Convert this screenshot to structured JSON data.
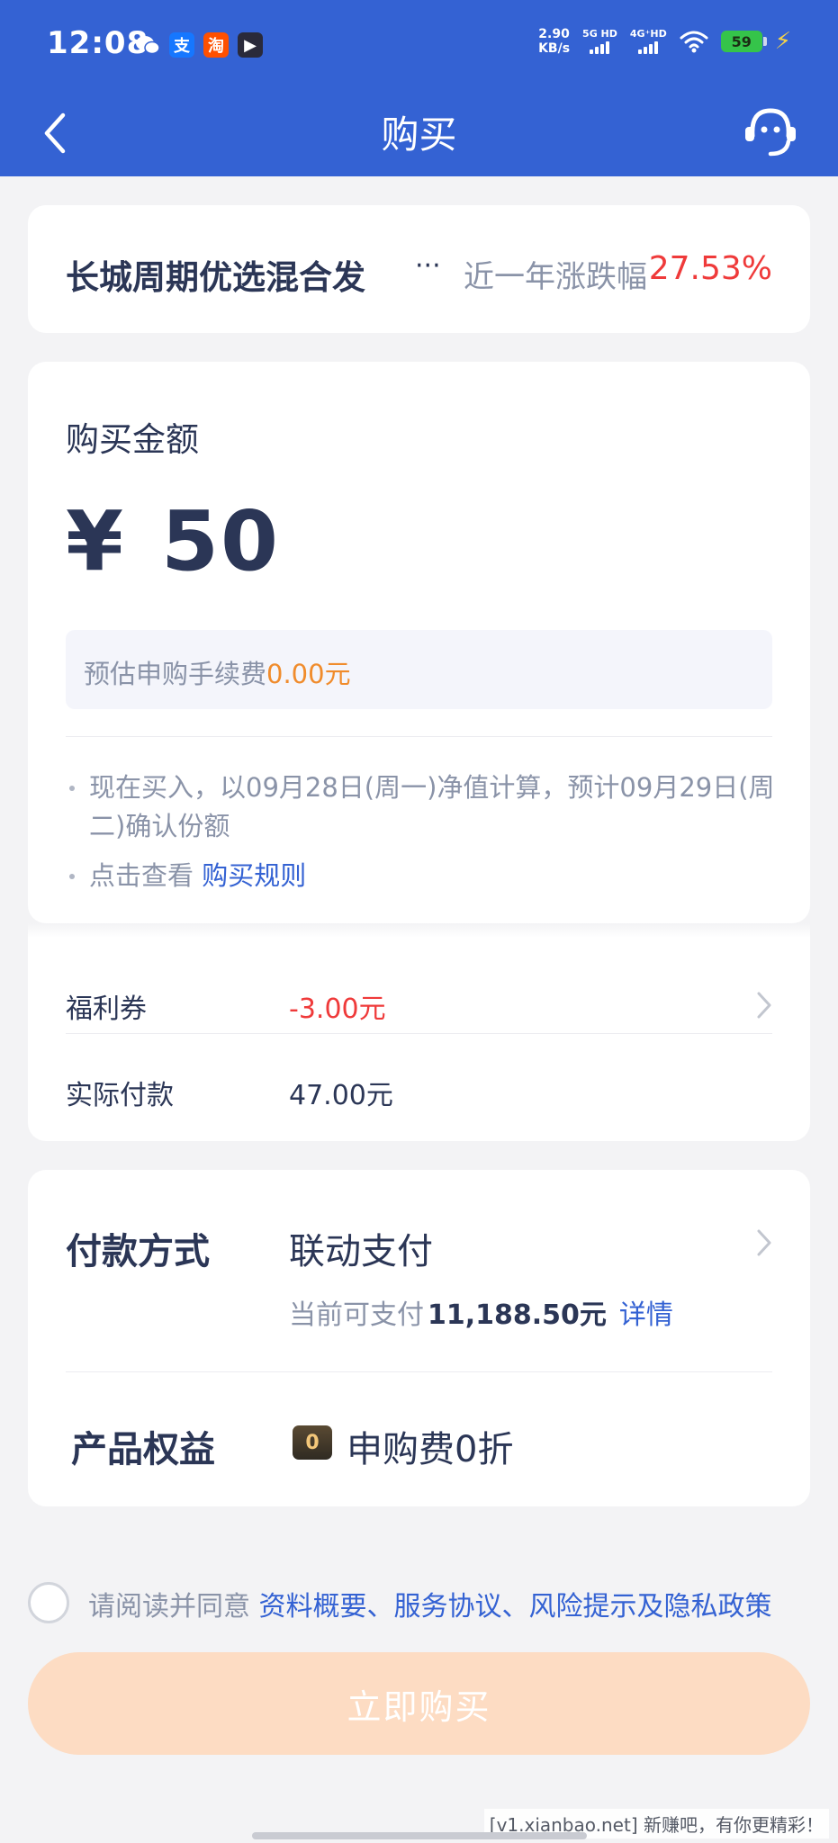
{
  "status_bar": {
    "time": "12:08",
    "app_icons": [
      "wechat-icon",
      "alipay-icon",
      "taobao-icon",
      "video-app-icon"
    ],
    "app_glyphs": {
      "alipay": "支",
      "taobao": "淘",
      "video": "▶"
    },
    "net_speed_value": "2.90",
    "net_speed_unit": "KB/s",
    "signal1_label": "5G HD",
    "signal2_label": "4G⁺HD",
    "battery_level": "59"
  },
  "header": {
    "title": "购买",
    "back_icon": "chevron-left-icon",
    "service_icon": "customer-service-icon",
    "background_color": "#3462d3"
  },
  "fund": {
    "name": "长城周期优选混合发",
    "ellipsis": "···",
    "yield_label": "近一年涨跌幅",
    "yield_value": "27.53%",
    "yield_color": "#ef3a3a"
  },
  "amount": {
    "label": "购买金额",
    "currency": "¥",
    "value": "50",
    "fee_label": "预估申购手续费",
    "fee_value": "0.00元",
    "notes": [
      "现在买入，以09月28日(周一)净值计算，预计09月29日(周二)确认份额"
    ],
    "rule_prefix": "点击查看",
    "rule_link": "购买规则"
  },
  "coupon": {
    "label": "福利券",
    "value": "-3.00元",
    "actual_label": "实际付款",
    "actual_value": "47.00元"
  },
  "payment": {
    "label": "付款方式",
    "method": "联动支付",
    "balance_prefix": "当前可支付",
    "balance_value": "11,188.50元",
    "details_link": "详情",
    "benefit_label": "产品权益",
    "benefit_icon_text": "0",
    "benefit_value": "申购费0折"
  },
  "agreement": {
    "prefix": "请阅读并同意",
    "links": "资料概要、服务协议、风险提示及隐私政策",
    "checked": false
  },
  "buy_button": {
    "label": "立即购买",
    "color": "#fddcc3"
  },
  "watermark": "[v1.xianbao.net] 新赚吧，有你更精彩！"
}
